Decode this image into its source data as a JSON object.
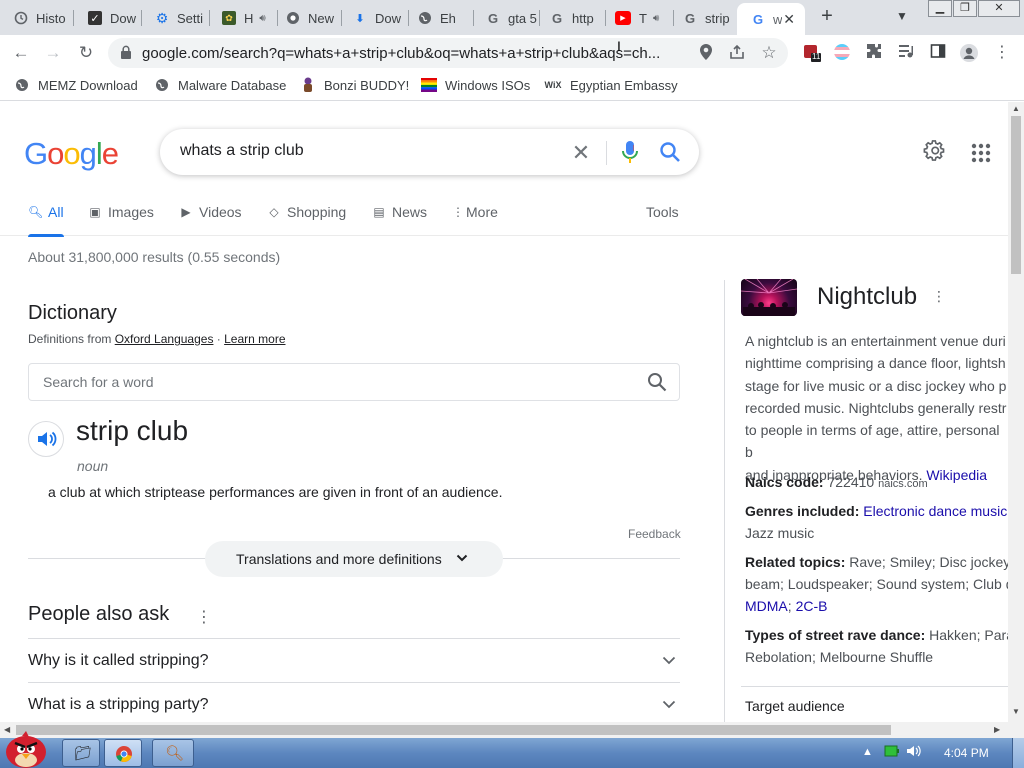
{
  "browser": {
    "tabs": [
      {
        "label": "Histo",
        "icon": "history-icon"
      },
      {
        "label": "Dow",
        "icon": "download-icon"
      },
      {
        "label": "Setti",
        "icon": "settings-gear-icon"
      },
      {
        "label": "H",
        "icon": "game-icon",
        "audio": true
      },
      {
        "label": "New",
        "icon": "chrome-icon"
      },
      {
        "label": "Dow",
        "icon": "download-arrow-icon"
      },
      {
        "label": "Eh",
        "icon": "globe-icon"
      },
      {
        "label": "gta 5",
        "icon": "google-g-icon"
      },
      {
        "label": "http",
        "icon": "google-g-icon"
      },
      {
        "label": "T",
        "icon": "youtube-icon",
        "audio": true
      },
      {
        "label": "strip",
        "icon": "google-g-icon"
      },
      {
        "label": "w",
        "icon": "google-g-icon",
        "active": true
      }
    ],
    "url": "google.com/search?q=whats+a+strip+club&oq=whats+a+strip+club&aqs=ch...",
    "bookmarks": [
      {
        "label": "MEMZ Download",
        "icon": "globe-icon"
      },
      {
        "label": "Malware Database",
        "icon": "globe-icon"
      },
      {
        "label": "Bonzi BUDDY!",
        "icon": "bonzi-icon"
      },
      {
        "label": "Windows ISOs",
        "icon": "rainbow-flag-icon"
      },
      {
        "label": "Egyptian Embassy",
        "icon": "wix-icon"
      }
    ],
    "extension_badge": "11"
  },
  "google": {
    "logo": "Google",
    "query": "whats a strip club",
    "nav": [
      "All",
      "Images",
      "Videos",
      "Shopping",
      "News",
      "More"
    ],
    "tools": "Tools",
    "stats": "About 31,800,000 results (0.55 seconds)"
  },
  "dictionary": {
    "title": "Dictionary",
    "source_prefix": "Definitions from ",
    "source": "Oxford Languages",
    "source_sep": " · ",
    "learn_more": "Learn more",
    "search_placeholder": "Search for a word",
    "word": "strip club",
    "part_of_speech": "noun",
    "definition": "a club at which striptease performances are given in front of an audience.",
    "feedback": "Feedback",
    "more_button": "Translations and more definitions"
  },
  "people_also_ask": {
    "title": "People also ask",
    "questions": [
      "Why is it called stripping?",
      "What is a stripping party?"
    ]
  },
  "knowledge_panel": {
    "title": "Nightclub",
    "description": "A nightclub is an entertainment venue duri\nnighttime comprising a dance floor, lightsh\nstage for live music or a disc jockey who p\nrecorded music. Nightclubs generally restr\nto people in terms of age, attire, personal b\nand inappropriate behaviors. ",
    "wiki": "Wikipedia",
    "naics_label": "Naics code:",
    "naics_value": " 722410 ",
    "naics_src": "naics.com",
    "genres_label": "Genres included:",
    "genres_link": "Electronic dance music",
    "genres_more": ", ",
    "genres_line2": "Jazz music",
    "topics_label": "Related topics:",
    "topics_line1": " Rave; Smiley; Disc jockey; V",
    "topics_line2": "beam; Loudspeaker; Sound system; Club d",
    "topics_links": [
      "MDMA",
      "2C-B"
    ],
    "topics_sep": "; ",
    "dance_label": "Types of street rave dance:",
    "dance_line1": " Hakken; Para P",
    "dance_line2": "Rebolation; Melbourne Shuffle",
    "target": "Target audience"
  },
  "taskbar": {
    "clock": "4:04 PM"
  }
}
